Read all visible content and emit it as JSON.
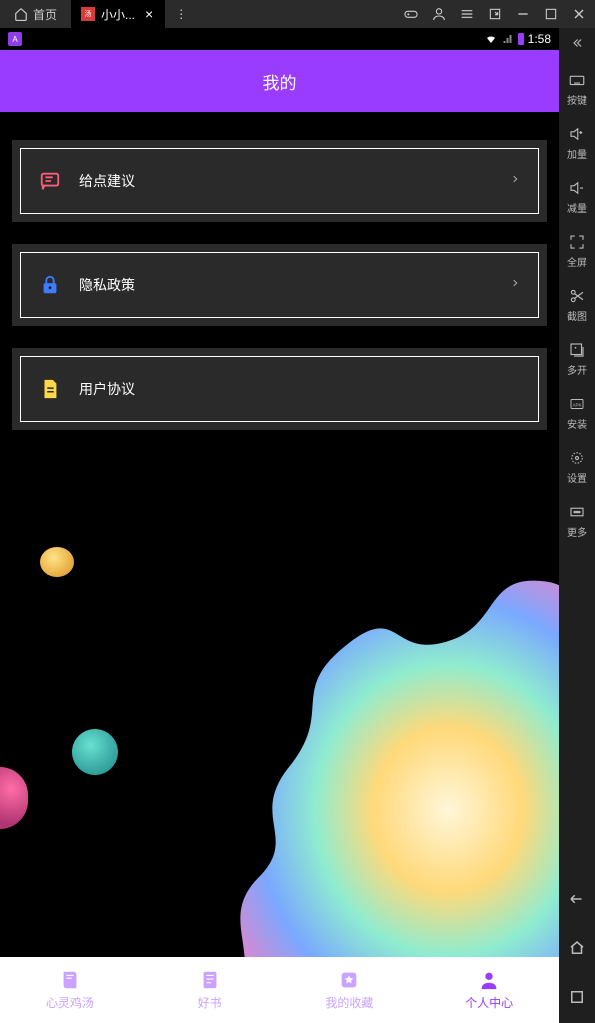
{
  "emulator": {
    "home_tab": "首页",
    "app_tab": "小小...",
    "topbar_icons": [
      "gamepad-icon",
      "user-icon",
      "menu-icon",
      "fullscreen-small-icon",
      "minimize-icon",
      "maximize-icon",
      "close-window-icon"
    ]
  },
  "sidebar": {
    "items": [
      {
        "icon": "keyboard-icon",
        "label": "按键"
      },
      {
        "icon": "volume-up-icon",
        "label": "加量"
      },
      {
        "icon": "volume-down-icon",
        "label": "减量"
      },
      {
        "icon": "fullscreen-icon",
        "label": "全屏"
      },
      {
        "icon": "scissors-icon",
        "label": "截图"
      },
      {
        "icon": "multi-open-icon",
        "label": "多开"
      },
      {
        "icon": "apk-icon",
        "label": "安装"
      },
      {
        "icon": "settings-icon",
        "label": "设置"
      },
      {
        "icon": "more-icon",
        "label": "更多"
      }
    ]
  },
  "status_bar": {
    "time": "1:58"
  },
  "header": {
    "title": "我的"
  },
  "menu": [
    {
      "icon": "chat-icon",
      "icon_color": "#ff5c7a",
      "label": "给点建议",
      "chevron": true
    },
    {
      "icon": "lock-icon",
      "icon_color": "#3d7bff",
      "label": "隐私政策",
      "chevron": true
    },
    {
      "icon": "document-icon",
      "icon_color": "#ffd84a",
      "label": "用户协议",
      "chevron": false
    }
  ],
  "bottom_nav": [
    {
      "icon": "book-icon",
      "label": "心灵鸡汤",
      "active": false
    },
    {
      "icon": "good-book-icon",
      "label": "好书",
      "active": false
    },
    {
      "icon": "star-icon",
      "label": "我的收藏",
      "active": false
    },
    {
      "icon": "person-icon",
      "label": "个人中心",
      "active": true
    }
  ]
}
